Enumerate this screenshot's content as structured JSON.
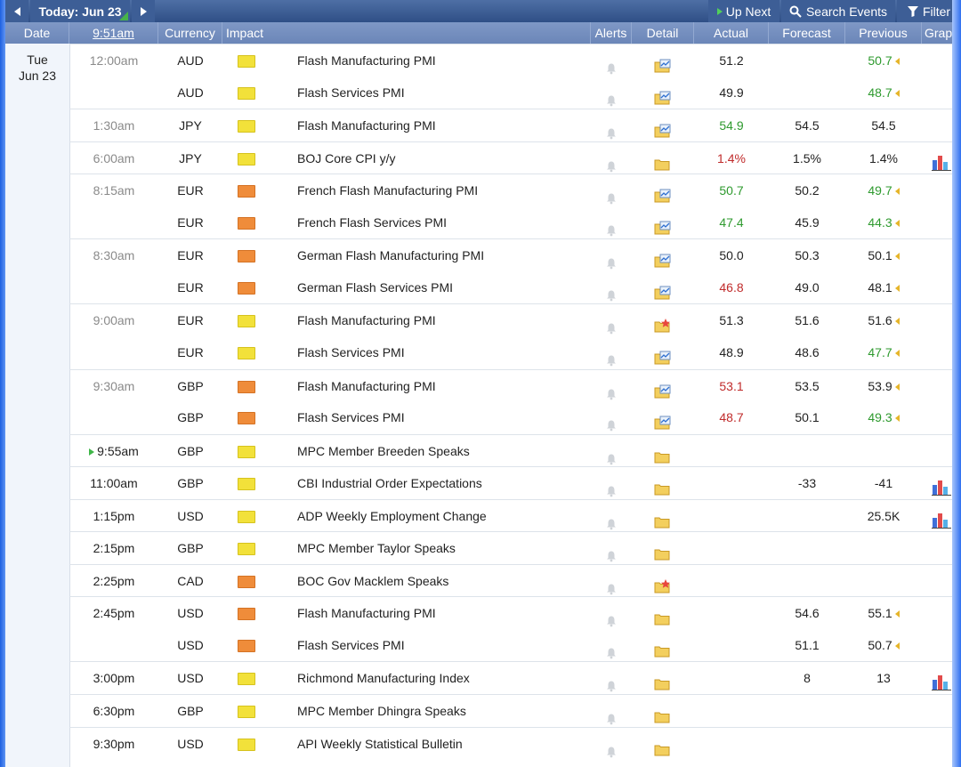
{
  "toolbar": {
    "today_label": "Today: Jun 23",
    "up_next_label": "Up Next",
    "search_label": "Search Events",
    "filter_label": "Filter"
  },
  "columns": {
    "date": "Date",
    "time": "9:51am",
    "currency": "Currency",
    "impact": "Impact",
    "alerts": "Alerts",
    "detail": "Detail",
    "actual": "Actual",
    "forecast": "Forecast",
    "previous": "Previous",
    "graph": "Graph"
  },
  "day": {
    "weekday": "Tue",
    "date": "Jun 23"
  },
  "colors": {
    "positive": "#2e9a2e",
    "negative": "#c02b2b",
    "impact_medium": "#f2e13a",
    "impact_high": "#ef8c3a"
  },
  "events": [
    {
      "time": "12:00am",
      "currency": "AUD",
      "impact": "yellow",
      "event": "Flash Manufacturing PMI",
      "detail": "folder-chart-icon",
      "actual": "51.2",
      "actual_status": "",
      "forecast": "",
      "previous": "50.7",
      "previous_status": "pos",
      "revised": true,
      "graph": false
    },
    {
      "time": "",
      "currency": "AUD",
      "impact": "yellow",
      "event": "Flash Services PMI",
      "detail": "folder-chart-icon",
      "actual": "49.9",
      "actual_status": "",
      "forecast": "",
      "previous": "48.7",
      "previous_status": "pos",
      "revised": true,
      "graph": false
    },
    {
      "time": "1:30am",
      "currency": "JPY",
      "impact": "yellow",
      "event": "Flash Manufacturing PMI",
      "detail": "folder-chart-icon",
      "actual": "54.9",
      "actual_status": "pos",
      "forecast": "54.5",
      "previous": "54.5",
      "previous_status": "",
      "revised": false,
      "graph": false
    },
    {
      "time": "6:00am",
      "currency": "JPY",
      "impact": "yellow",
      "event": "BOJ Core CPI y/y",
      "detail": "folder-icon",
      "actual": "1.4%",
      "actual_status": "neg",
      "forecast": "1.5%",
      "previous": "1.4%",
      "previous_status": "",
      "revised": false,
      "graph": true
    },
    {
      "time": "8:15am",
      "currency": "EUR",
      "impact": "orange",
      "event": "French Flash Manufacturing PMI",
      "detail": "folder-chart-icon",
      "actual": "50.7",
      "actual_status": "pos",
      "forecast": "50.2",
      "previous": "49.7",
      "previous_status": "pos",
      "revised": true,
      "graph": false
    },
    {
      "time": "",
      "currency": "EUR",
      "impact": "orange",
      "event": "French Flash Services PMI",
      "detail": "folder-chart-icon",
      "actual": "47.4",
      "actual_status": "pos",
      "forecast": "45.9",
      "previous": "44.3",
      "previous_status": "pos",
      "revised": true,
      "graph": false
    },
    {
      "time": "8:30am",
      "currency": "EUR",
      "impact": "orange",
      "event": "German Flash Manufacturing PMI",
      "detail": "folder-chart-icon",
      "actual": "50.0",
      "actual_status": "",
      "forecast": "50.3",
      "previous": "50.1",
      "previous_status": "",
      "revised": true,
      "graph": false
    },
    {
      "time": "",
      "currency": "EUR",
      "impact": "orange",
      "event": "German Flash Services PMI",
      "detail": "folder-chart-icon",
      "actual": "46.8",
      "actual_status": "neg",
      "forecast": "49.0",
      "previous": "48.1",
      "previous_status": "",
      "revised": true,
      "graph": false
    },
    {
      "time": "9:00am",
      "currency": "EUR",
      "impact": "yellow",
      "event": "Flash Manufacturing PMI",
      "detail": "folder-star-icon",
      "actual": "51.3",
      "actual_status": "",
      "forecast": "51.6",
      "previous": "51.6",
      "previous_status": "",
      "revised": true,
      "graph": false
    },
    {
      "time": "",
      "currency": "EUR",
      "impact": "yellow",
      "event": "Flash Services PMI",
      "detail": "folder-chart-icon",
      "actual": "48.9",
      "actual_status": "",
      "forecast": "48.6",
      "previous": "47.7",
      "previous_status": "pos",
      "revised": true,
      "graph": false
    },
    {
      "time": "9:30am",
      "currency": "GBP",
      "impact": "orange",
      "event": "Flash Manufacturing PMI",
      "detail": "folder-chart-icon",
      "actual": "53.1",
      "actual_status": "neg",
      "forecast": "53.5",
      "previous": "53.9",
      "previous_status": "",
      "revised": true,
      "graph": false
    },
    {
      "time": "",
      "currency": "GBP",
      "impact": "orange",
      "event": "Flash Services PMI",
      "detail": "folder-chart-icon",
      "actual": "48.7",
      "actual_status": "neg",
      "forecast": "50.1",
      "previous": "49.3",
      "previous_status": "pos",
      "revised": true,
      "graph": false
    },
    {
      "time": "9:55am",
      "currency": "GBP",
      "impact": "yellow",
      "event": "MPC Member Breeden Speaks",
      "detail": "folder-icon",
      "actual": "",
      "actual_status": "",
      "forecast": "",
      "previous": "",
      "previous_status": "",
      "revised": false,
      "graph": false,
      "next": true
    },
    {
      "time": "11:00am",
      "currency": "GBP",
      "impact": "yellow",
      "event": "CBI Industrial Order Expectations",
      "detail": "folder-icon",
      "actual": "",
      "actual_status": "",
      "forecast": "-33",
      "previous": "-41",
      "previous_status": "",
      "revised": false,
      "graph": true
    },
    {
      "time": "1:15pm",
      "currency": "USD",
      "impact": "yellow",
      "event": "ADP Weekly Employment Change",
      "detail": "folder-icon",
      "actual": "",
      "actual_status": "",
      "forecast": "",
      "previous": "25.5K",
      "previous_status": "",
      "revised": false,
      "graph": true
    },
    {
      "time": "2:15pm",
      "currency": "GBP",
      "impact": "yellow",
      "event": "MPC Member Taylor Speaks",
      "detail": "folder-icon",
      "actual": "",
      "actual_status": "",
      "forecast": "",
      "previous": "",
      "previous_status": "",
      "revised": false,
      "graph": false
    },
    {
      "time": "2:25pm",
      "currency": "CAD",
      "impact": "orange",
      "event": "BOC Gov Macklem Speaks",
      "detail": "folder-star-icon",
      "actual": "",
      "actual_status": "",
      "forecast": "",
      "previous": "",
      "previous_status": "",
      "revised": false,
      "graph": false
    },
    {
      "time": "2:45pm",
      "currency": "USD",
      "impact": "orange",
      "event": "Flash Manufacturing PMI",
      "detail": "folder-icon",
      "actual": "",
      "actual_status": "",
      "forecast": "54.6",
      "previous": "55.1",
      "previous_status": "",
      "revised": true,
      "graph": false
    },
    {
      "time": "",
      "currency": "USD",
      "impact": "orange",
      "event": "Flash Services PMI",
      "detail": "folder-icon",
      "actual": "",
      "actual_status": "",
      "forecast": "51.1",
      "previous": "50.7",
      "previous_status": "",
      "revised": true,
      "graph": false
    },
    {
      "time": "3:00pm",
      "currency": "USD",
      "impact": "yellow",
      "event": "Richmond Manufacturing Index",
      "detail": "folder-icon",
      "actual": "",
      "actual_status": "",
      "forecast": "8",
      "previous": "13",
      "previous_status": "",
      "revised": false,
      "graph": true
    },
    {
      "time": "6:30pm",
      "currency": "GBP",
      "impact": "yellow",
      "event": "MPC Member Dhingra Speaks",
      "detail": "folder-icon",
      "actual": "",
      "actual_status": "",
      "forecast": "",
      "previous": "",
      "previous_status": "",
      "revised": false,
      "graph": false
    },
    {
      "time": "9:30pm",
      "currency": "USD",
      "impact": "yellow",
      "event": "API Weekly Statistical Bulletin",
      "detail": "folder-icon",
      "actual": "",
      "actual_status": "",
      "forecast": "",
      "previous": "",
      "previous_status": "",
      "revised": false,
      "graph": false
    }
  ]
}
